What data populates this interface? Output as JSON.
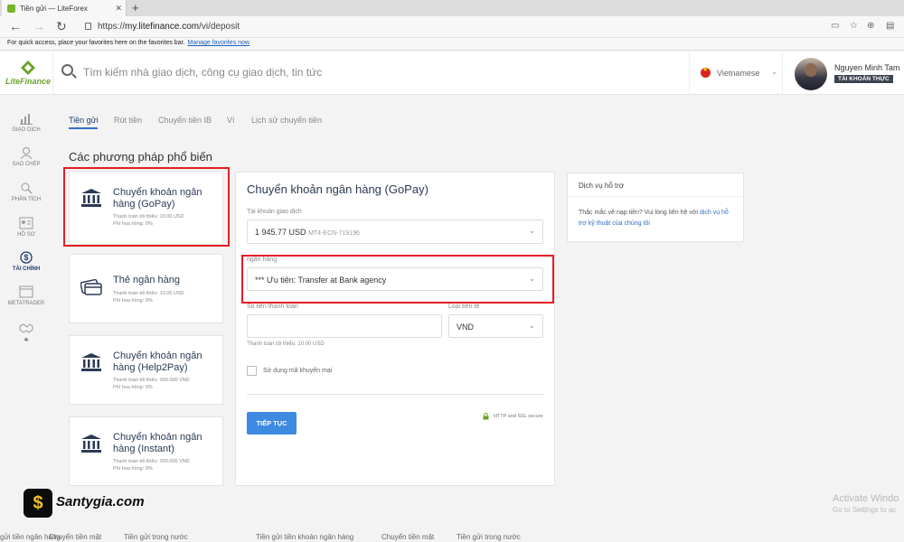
{
  "browser": {
    "tab_title": "Tiền gửi — LiteForex",
    "url_prefix": "https://",
    "url_host": "my.litefinance.com",
    "url_path": "/vi/deposit",
    "favorites_text": "For quick access, place your favorites here on the favorites bar.",
    "favorites_link": "Manage favorites now"
  },
  "header": {
    "logo_text": "LiteFinance",
    "search_placeholder": "Tìm kiếm nhà giao dịch, công cụ giao dịch, tin tức",
    "language": "Vietnamese",
    "user_name": "Nguyen Minh Tam",
    "account_badge": "TÀI KHOẢN THỰC"
  },
  "sidebar": {
    "items": [
      {
        "label": "GIAO DỊCH",
        "icon": "chart-bars-icon"
      },
      {
        "label": "SAO CHÉP",
        "icon": "copy-trader-icon"
      },
      {
        "label": "PHÂN TÍCH",
        "icon": "analysis-icon"
      },
      {
        "label": "HỒ SƠ",
        "icon": "profile-card-icon"
      },
      {
        "label": "TÀI CHÍNH",
        "icon": "dollar-icon"
      },
      {
        "label": "METATRADER",
        "icon": "window-icon"
      },
      {
        "label": "",
        "icon": "handshake-icon"
      }
    ]
  },
  "tabs": [
    "Tiền gửi",
    "Rút tiền",
    "Chuyển tiền IB",
    "Ví",
    "Lịch sử chuyển tiền"
  ],
  "section_title": "Các phương pháp phổ biến",
  "methods": [
    {
      "name": "Chuyển khoản ngân hàng (GoPay)",
      "min": "Thanh toán tối thiểu: 10.00 USD",
      "fee": "Phí hoa hồng: 0%"
    },
    {
      "name": "Thẻ ngân hàng",
      "min": "Thanh toán tối thiểu: 10.00 USD",
      "fee": "Phí hoa hồng: 0%"
    },
    {
      "name": "Chuyển khoản ngân hàng (Help2Pay)",
      "min": "Thanh toán tối thiểu: 300.000 VND",
      "fee": "Phí hoa hồng: 0%"
    },
    {
      "name": "Chuyển khoản ngân hàng (Instant)",
      "min": "Thanh toán tối thiểu: 300.000 VND",
      "fee": "Phí hoa hồng: 0%"
    }
  ],
  "form": {
    "title": "Chuyển khoản ngân hàng (GoPay)",
    "account_label": "Tài khoản giao dịch",
    "account_amount": "1 945.77 USD",
    "account_id": "MT4-ECN-719196",
    "bank_label": "ngân hàng",
    "bank_value": "*** Ưu tiên: Transfer at Bank agency",
    "amount_label": "Số tiền thanh toán",
    "amount_value": "",
    "amount_hint": "Thanh toán tối thiểu: 10.00 USD",
    "currency_label": "Loại tiền tệ",
    "currency_value": "VND",
    "promo_label": "Sử dụng mã khuyến mại",
    "continue_button": "TIẾP TỤC",
    "secure_text": "HTTP and SSL secure"
  },
  "support": {
    "title": "Dịch vụ hỗ trợ",
    "body": "Thắc mắc về nạp tiền? Vui lòng liên hệ với ",
    "link": "dịch vụ hỗ trợ kỹ thuật của chúng tôi"
  },
  "watermark": {
    "icon": "$",
    "text": "Santygia.com"
  },
  "windows": {
    "activate_title": "Activate Windo",
    "activate_sub": "Go to Settings to ac"
  },
  "bottom_links": [
    "gửi tiền ngân hàng",
    "Chuyển tiền mặt",
    "Tiền gửi trong nước",
    "Tiền gửi tiền khoản ngân hàng",
    "Chuyển tiền mặt",
    "Tiền gửi trong nước"
  ],
  "colors": {
    "accent": "#3d8ae0",
    "highlight_box": "#e31e24",
    "brand": "#6aa329"
  }
}
